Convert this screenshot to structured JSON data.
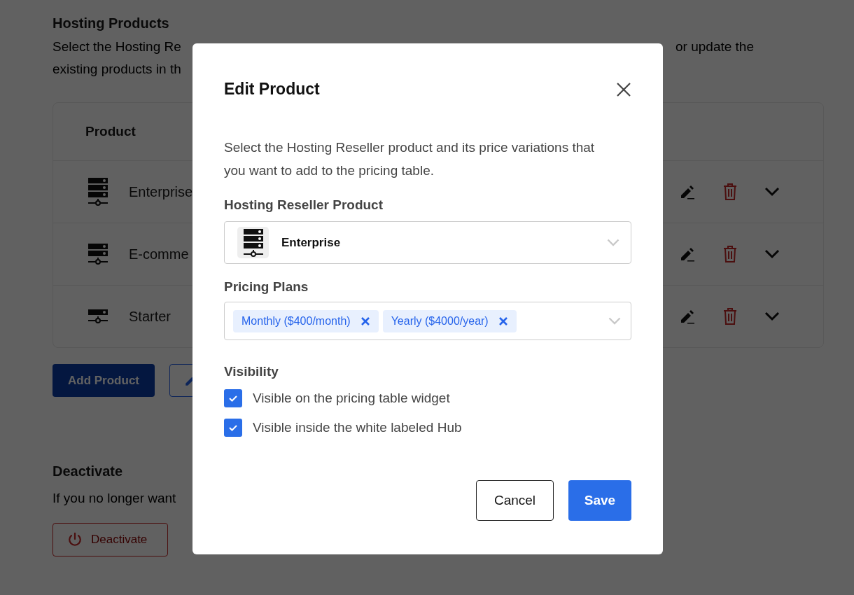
{
  "page": {
    "title": "Hosting Products",
    "description_fragments": [
      "Select the Hosting Re",
      "or update the",
      "existing products in th"
    ],
    "table": {
      "columns": [
        "Product"
      ],
      "rows": [
        {
          "name": "Enterprise",
          "kind": "large"
        },
        {
          "name": "E-comme",
          "kind": "medium"
        },
        {
          "name": "Starter",
          "kind": "small"
        }
      ]
    },
    "add_button": "Add Product",
    "deactivate": {
      "title": "Deactivate",
      "description": "If you no longer want",
      "button": "Deactivate"
    }
  },
  "modal": {
    "title": "Edit Product",
    "description": "Select the Hosting Reseller product and its price variations that you want to add to the pricing table.",
    "product_field": {
      "label": "Hosting Reseller Product",
      "value": "Enterprise"
    },
    "plans_field": {
      "label": "Pricing Plans",
      "tags": [
        "Monthly ($400/month)",
        "Yearly ($4000/year)"
      ]
    },
    "visibility": {
      "label": "Visibility",
      "options": [
        {
          "label": "Visible on the pricing table widget",
          "checked": true
        },
        {
          "label": "Visible inside the white labeled Hub",
          "checked": true
        }
      ]
    },
    "buttons": {
      "cancel": "Cancel",
      "save": "Save"
    }
  }
}
